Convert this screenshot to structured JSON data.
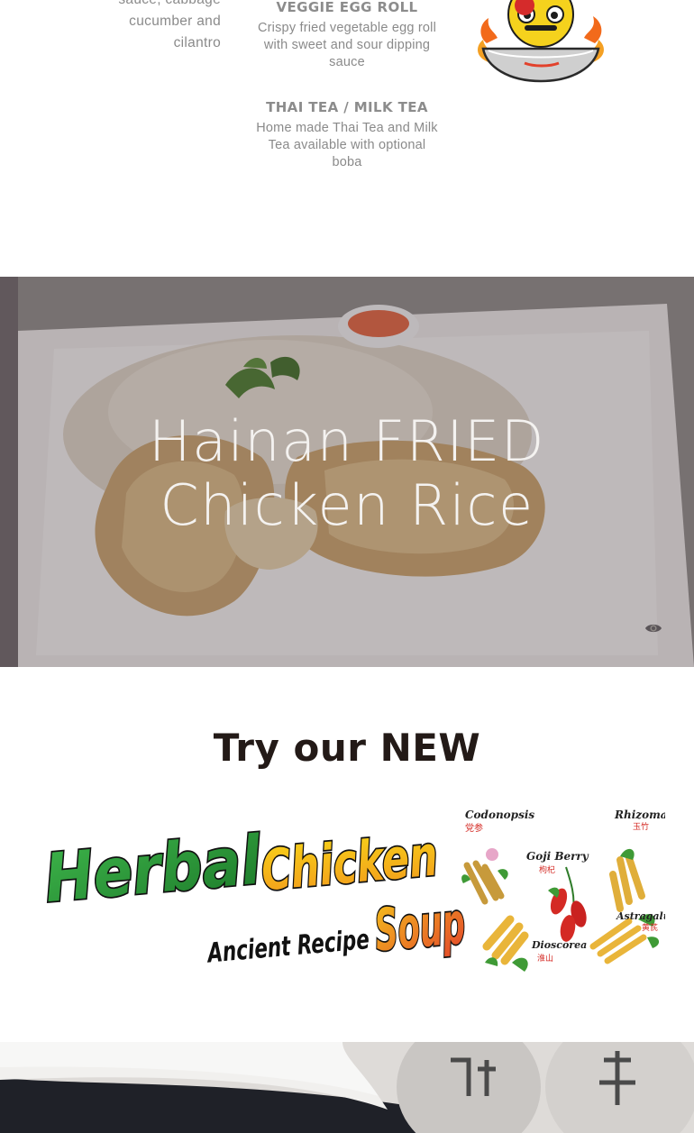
{
  "left_column": {
    "description": "sauce, cabbage\ncucumber and\ncilantro"
  },
  "menu": {
    "items": [
      {
        "name": "VEGGIE EGG ROLL",
        "description": "Crispy fried vegetable egg roll with sweet and sour dipping sauce"
      },
      {
        "name": "THAI TEA / MILK TEA",
        "description": "Home made Thai Tea and Milk Tea available with optional boba"
      }
    ]
  },
  "hero": {
    "title": "Hainan FRIED Chicken Rice",
    "icon": "eye-icon"
  },
  "promo": {
    "heading": "Try our NEW",
    "banner": {
      "word_1": "Herbal",
      "word_2": "Chicken",
      "word_3": "Ancient Recipe",
      "word_4": "Soup",
      "herbs": [
        {
          "name": "Codonopsis",
          "chinese": "党参"
        },
        {
          "name": "Rhizoma",
          "chinese": "玉竹"
        },
        {
          "name": "Goji Berry",
          "chinese": "枸杞"
        },
        {
          "name": "Astragalus",
          "chinese": "黄芪"
        },
        {
          "name": "Dioscorea",
          "chinese": "淮山"
        }
      ]
    }
  },
  "colors": {
    "heading": "#231a17",
    "muted_text": "#8a8a8a",
    "hero_text": "#f4f2f0"
  }
}
